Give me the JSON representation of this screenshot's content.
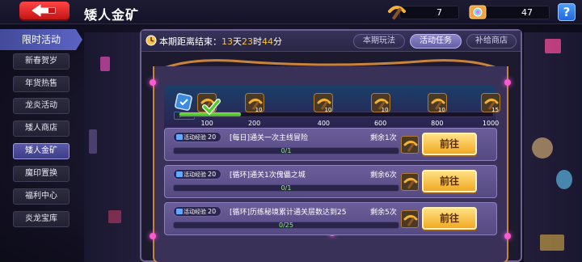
{
  "header": {
    "title": "矮人金矿",
    "pickaxe_count": "7",
    "gem_count": "47",
    "help_label": "?"
  },
  "sidebar": {
    "header": "限时活动",
    "items": [
      {
        "label": "新春贺岁",
        "active": false
      },
      {
        "label": "年货热售",
        "active": false
      },
      {
        "label": "龙炎活动",
        "active": false
      },
      {
        "label": "矮人商店",
        "active": false
      },
      {
        "label": "矮人金矿",
        "active": true
      },
      {
        "label": "魔印置换",
        "active": false
      },
      {
        "label": "福利中心",
        "active": false
      },
      {
        "label": "炎龙宝库",
        "active": false
      }
    ]
  },
  "panel": {
    "timer_prefix": "本期距离结束：",
    "days": "13",
    "days_unit": "天",
    "hours": "23",
    "hours_unit": "时",
    "minutes": "44",
    "minutes_unit": "分",
    "tabs": [
      {
        "label": "本期玩法",
        "active": false
      },
      {
        "label": "活动任务",
        "active": true
      },
      {
        "label": "补给商店",
        "active": false
      }
    ]
  },
  "progress_track": {
    "current": "170",
    "current_value": 170,
    "max_value": 1000,
    "ticks": [
      "100",
      "200",
      "400",
      "600",
      "800",
      "1000"
    ],
    "rewards": [
      {
        "count": "10",
        "claimed": true,
        "icon": "pickaxe-icon"
      },
      {
        "count": "10",
        "claimed": false,
        "icon": "pickaxe-icon"
      },
      {
        "count": "10",
        "claimed": false,
        "icon": "pickaxe-icon"
      },
      {
        "count": "10",
        "claimed": false,
        "icon": "pickaxe-icon"
      },
      {
        "count": "10",
        "claimed": false,
        "icon": "pickaxe-icon"
      },
      {
        "count": "15",
        "claimed": false,
        "icon": "pickaxe-icon"
      }
    ]
  },
  "tasks": [
    {
      "xp_label": "活动经验",
      "xp": "20",
      "name": "[每日]通关一次主线冒险",
      "remaining": "剩余1次",
      "progress": "0/1",
      "button": "前往"
    },
    {
      "xp_label": "活动经验",
      "xp": "20",
      "name": "[循环]通关1次傀儡之城",
      "remaining": "剩余6次",
      "progress": "0/1",
      "button": "前往"
    },
    {
      "xp_label": "活动经验",
      "xp": "20",
      "name": "[循环]历练秘境累计通关层数达到25",
      "remaining": "剩余5次",
      "progress": "0/25",
      "button": "前往"
    }
  ],
  "colors": {
    "accent_gold": "#f6c246",
    "tab_active": "#6660a8",
    "back_button": "#e02525",
    "progress_green": "#8df07a"
  }
}
